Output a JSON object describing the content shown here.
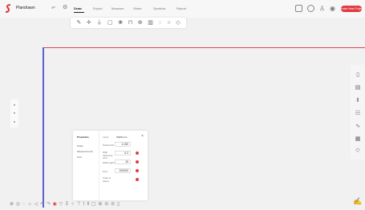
{
  "app": {
    "project_name": "Plandrawn"
  },
  "topbar": {
    "tabs": [
      {
        "label": "Draw",
        "active": true
      },
      {
        "label": "Export",
        "active": false
      },
      {
        "label": "Measure",
        "active": false
      },
      {
        "label": "Share",
        "active": false
      },
      {
        "label": "Symbols",
        "active": false
      },
      {
        "label": "Report",
        "active": false
      }
    ],
    "create_label": "Create New Project",
    "accent_color": "#e03a42"
  },
  "draw_toolbar": {
    "tools": [
      "pencil-icon",
      "move-icon",
      "anchor-icon",
      "rectangle-icon",
      "shape-icon",
      "door-icon",
      "dimension-icon",
      "columns-icon",
      "circle-icon",
      "circle-outline-icon",
      "tag-icon"
    ]
  },
  "properties": {
    "title": "Properties",
    "sections": [
      "Scale",
      "Measurements",
      "Grid"
    ],
    "rows": [
      {
        "label": "Layer",
        "value": "Wall/room"
      },
      {
        "label": "Scale/ratio",
        "value": "1:100"
      },
      {
        "label": "Wall thickness (cm)",
        "value": "0.2"
      },
      {
        "label": "Wall height",
        "value": "15"
      },
      {
        "label": "Grid",
        "value": "100000"
      },
      {
        "label": "Snap to object",
        "value": ""
      }
    ]
  },
  "colors": {
    "ruler_horizontal": "#e0474f",
    "ruler_vertical": "#5b62d3"
  }
}
